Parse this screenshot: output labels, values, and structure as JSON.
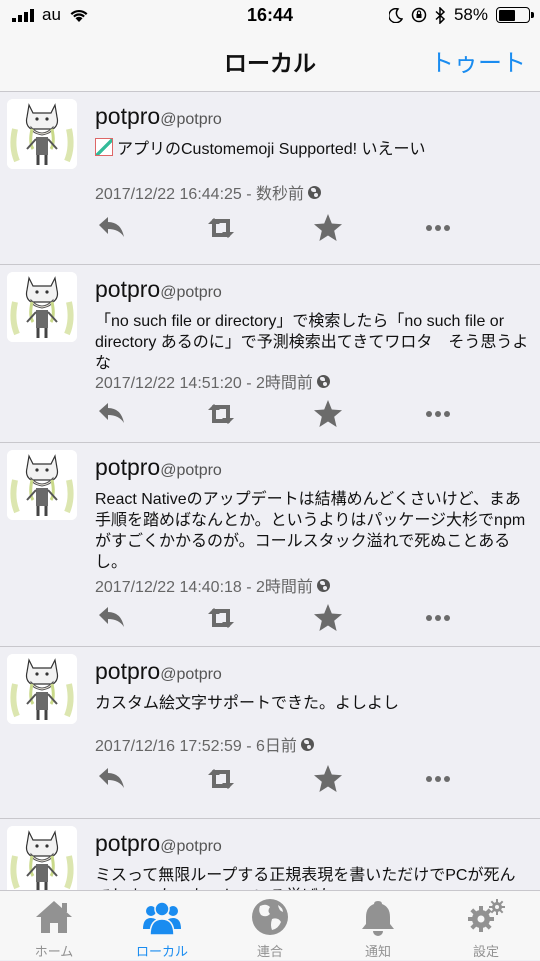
{
  "status_bar": {
    "carrier": "au",
    "time": "16:44",
    "battery_percent": "58%",
    "battery_level": 0.58,
    "icons": [
      "signal-icon",
      "wifi-icon",
      "moon-icon",
      "orientation-lock-icon",
      "bluetooth-icon",
      "battery-icon"
    ]
  },
  "nav": {
    "title": "ローカル",
    "toot_button": "トゥート"
  },
  "toots": [
    {
      "name": "potpro",
      "acct": "@potpro",
      "emoji": "custom-emoji-icon",
      "content": "アプリのCustomemoji Supported! いえーい",
      "timestamp": "2017/12/22 16:44:25 - 数秒前"
    },
    {
      "name": "potpro",
      "acct": "@potpro",
      "content": "「no such file or directory」で検索したら「no such file or directory あるのに」で予測検索出てきてワロタ　そう思うよな",
      "timestamp": "2017/12/22 14:51:20 - 2時間前"
    },
    {
      "name": "potpro",
      "acct": "@potpro",
      "content": "React Nativeのアップデートは結構めんどくさいけど、まあ手順を踏めばなんとか。というよりはパッケージ大杉でnpmがすごくかかるのが。コールスタック溢れで死ぬことあるし。",
      "timestamp": "2017/12/22 14:40:18 - 2時間前"
    },
    {
      "name": "potpro",
      "acct": "@potpro",
      "content": "カスタム絵文字サポートできた。よしよし",
      "timestamp": "2017/12/16 17:52:59 - 6日前"
    },
    {
      "name": "potpro",
      "acct": "@potpro",
      "content": "ミスって無限ループする正規表現を書いただけでPCが死んでしまった。もっと、いろ学ばな",
      "timestamp": ""
    }
  ],
  "tabs": [
    {
      "label": "ホーム",
      "icon": "home-icon",
      "active": false
    },
    {
      "label": "ローカル",
      "icon": "people-icon",
      "active": true
    },
    {
      "label": "連合",
      "icon": "globe-icon",
      "active": false
    },
    {
      "label": "通知",
      "icon": "bell-icon",
      "active": false
    },
    {
      "label": "設定",
      "icon": "gears-icon",
      "active": false
    }
  ],
  "colors": {
    "accent": "#1a8cf0",
    "tab_inactive": "#929292",
    "background": "#efeff4",
    "action_icon": "#6b6b6b"
  }
}
